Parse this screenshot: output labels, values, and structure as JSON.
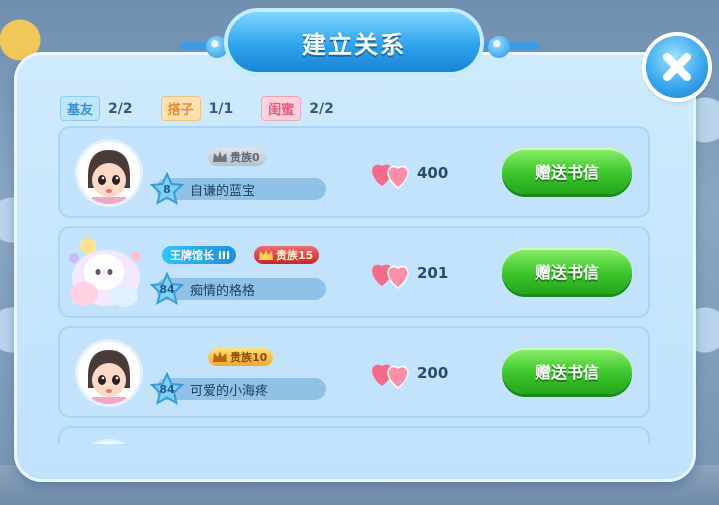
{
  "header": {
    "title": "建立关系"
  },
  "counts": [
    {
      "tag": "基友",
      "value": "2/2",
      "style": "blue"
    },
    {
      "tag": "搭子",
      "value": "1/1",
      "style": "orange"
    },
    {
      "tag": "闺蜜",
      "value": "2/2",
      "style": "pink"
    }
  ],
  "friends": [
    {
      "name": "自谦的蓝宝",
      "level": "8",
      "rank": "贵族0",
      "rank_style": "gray",
      "affinity": "400",
      "action": "赠送书信"
    },
    {
      "name": "痴情的格格",
      "level": "84",
      "title_badge": "王牌馆长 III",
      "rank": "贵族15",
      "rank_style": "red",
      "affinity": "201",
      "action": "赠送书信"
    },
    {
      "name": "可爱的小海疼",
      "level": "84",
      "rank": "贵族10",
      "rank_style": "gold",
      "affinity": "200",
      "action": "赠送书信"
    }
  ],
  "colors": {
    "accent_blue": "#2fa3ee",
    "button_green": "#3cc62b",
    "card_bg": "#c2e3fb"
  }
}
